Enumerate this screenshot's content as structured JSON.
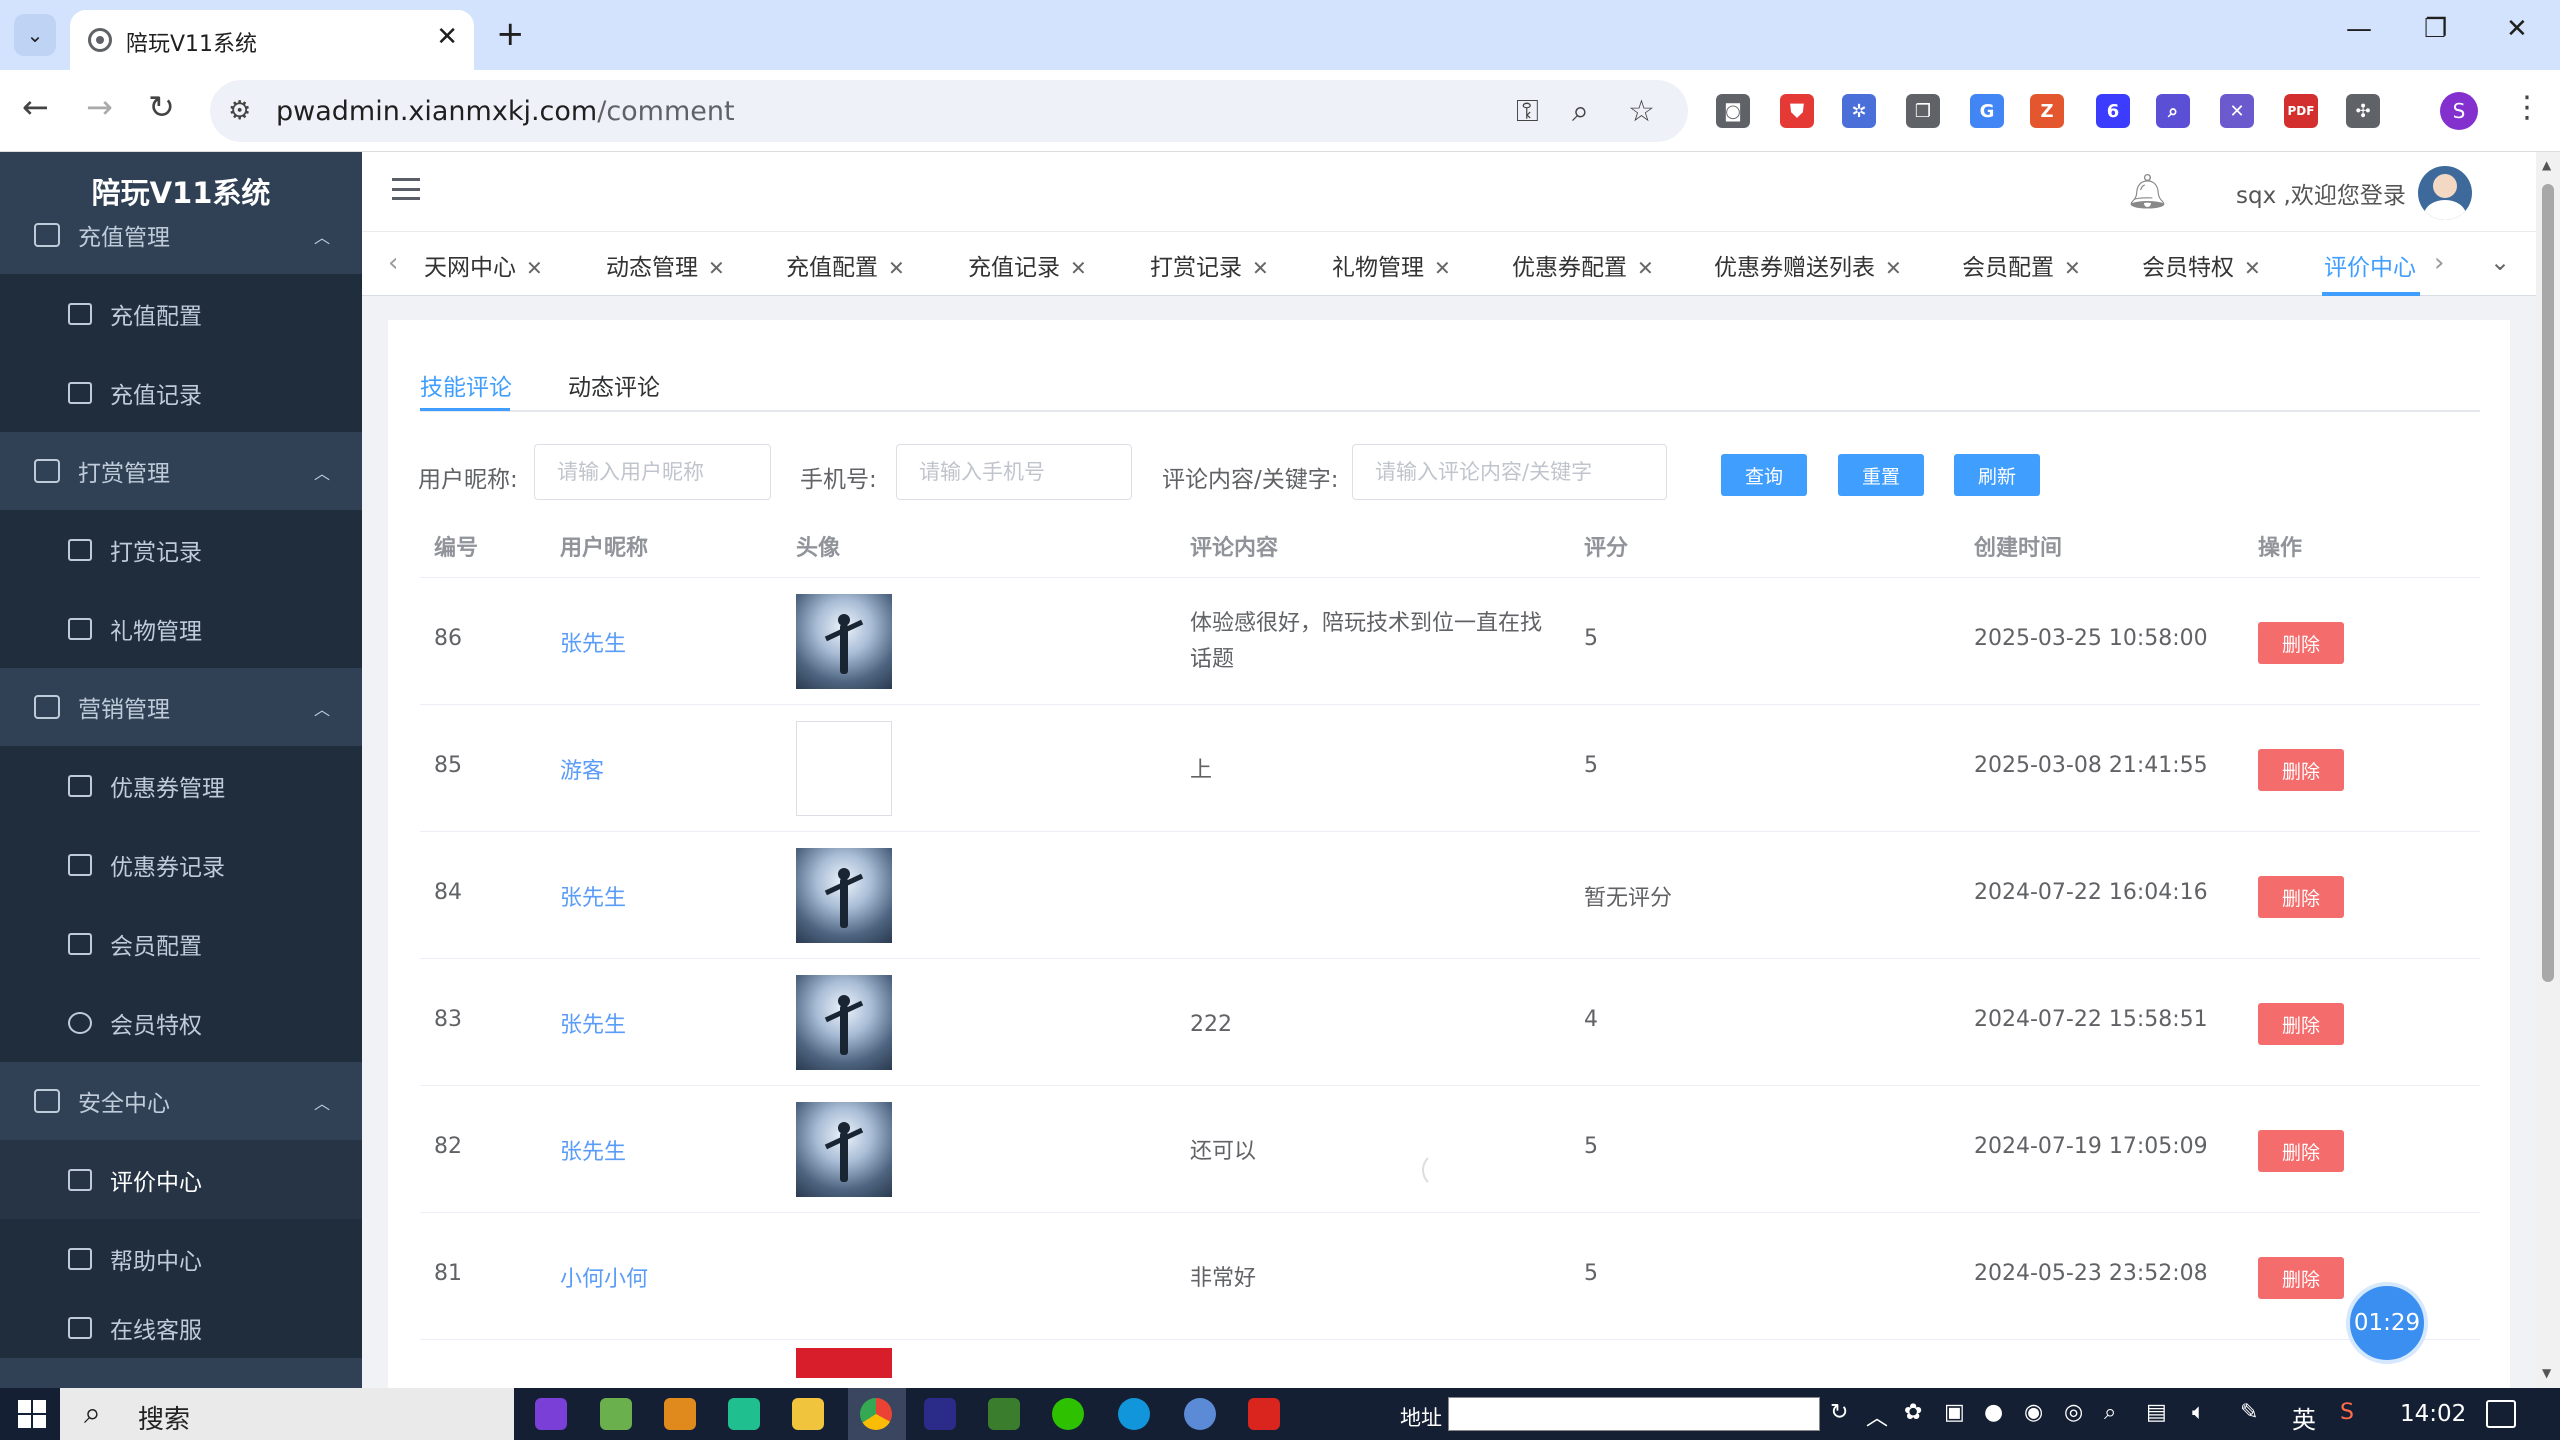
{
  "browser": {
    "tab_title": "陪玩V11系统",
    "url_host": "pwadmin.xianmxkj.com",
    "url_path": "/comment",
    "extensions": [
      {
        "name": "camera-icon",
        "color": "#5f6368",
        "glyph": "◙"
      },
      {
        "name": "shield-extension-icon",
        "color": "#e53935",
        "glyph": "⛊"
      },
      {
        "name": "network-extension-icon",
        "color": "#4a6fd8",
        "glyph": "✲"
      },
      {
        "name": "copy-extension-icon",
        "color": "#5f6368",
        "glyph": "❐"
      },
      {
        "name": "translate-extension-icon",
        "color": "#4285f4",
        "glyph": "G"
      },
      {
        "name": "zotero-extension-icon",
        "color": "#e4572e",
        "glyph": "Z"
      },
      {
        "name": "badge-extension-icon",
        "color": "#3c3cff",
        "glyph": "6"
      },
      {
        "name": "search-extension-icon",
        "color": "#5b4fd6",
        "glyph": "⌕"
      },
      {
        "name": "x-extension-icon",
        "color": "#6a5acd",
        "glyph": "✕"
      },
      {
        "name": "pdf-extension-icon",
        "color": "#d32f2f",
        "glyph": "PDF"
      },
      {
        "name": "puzzle-extension-icon",
        "color": "#5f6368",
        "glyph": "✣"
      }
    ],
    "profile_initial": "S"
  },
  "sidebar": {
    "logo": "陪玩V11系统",
    "sections": [
      {
        "label": "充值管理",
        "items": [
          "充值配置",
          "充值记录"
        ]
      },
      {
        "label": "打赏管理",
        "items": [
          "打赏记录",
          "礼物管理"
        ]
      },
      {
        "label": "营销管理",
        "items": [
          "优惠券管理",
          "优惠券记录",
          "会员配置",
          "会员特权"
        ]
      },
      {
        "label": "安全中心",
        "items": [
          "评价中心",
          "帮助中心",
          "在线客服"
        ]
      }
    ]
  },
  "header": {
    "welcome": "sqx ,欢迎您登录"
  },
  "tags": [
    "天网中心",
    "动态管理",
    "充值配置",
    "充值记录",
    "打赏记录",
    "礼物管理",
    "优惠券配置",
    "优惠券赠送列表",
    "会员配置",
    "会员特权",
    "评价中心"
  ],
  "active_tag": "评价中心",
  "subtabs": [
    "技能评论",
    "动态评论"
  ],
  "filters": {
    "nickname_label": "用户昵称:",
    "nickname_placeholder": "请输入用户昵称",
    "phone_label": "手机号:",
    "phone_placeholder": "请输入手机号",
    "keyword_label": "评论内容/关键字:",
    "keyword_placeholder": "请输入评论内容/关键字",
    "query_btn": "查询",
    "reset_btn": "重置",
    "refresh_btn": "刷新"
  },
  "table": {
    "headers": [
      "编号",
      "用户昵称",
      "头像",
      "评论内容",
      "评分",
      "创建时间",
      "操作"
    ],
    "delete_label": "删除",
    "rows": [
      {
        "id": "86",
        "name": "张先生",
        "avatar": "photo",
        "content": "体验感很好，陪玩技术到位一直在找话题",
        "score": "5",
        "time": "2025-03-25 10:58:00"
      },
      {
        "id": "85",
        "name": "游客",
        "avatar": "blank",
        "content": "上",
        "score": "5",
        "time": "2025-03-08 21:41:55"
      },
      {
        "id": "84",
        "name": "张先生",
        "avatar": "photo",
        "content": "",
        "score": "暂无评分",
        "time": "2024-07-22 16:04:16"
      },
      {
        "id": "83",
        "name": "张先生",
        "avatar": "photo",
        "content": "222",
        "score": "4",
        "time": "2024-07-22 15:58:51"
      },
      {
        "id": "82",
        "name": "张先生",
        "avatar": "photo",
        "content": "还可以",
        "score": "5",
        "time": "2024-07-19 17:05:09"
      },
      {
        "id": "81",
        "name": "小何小何",
        "avatar": "none",
        "content": "非常好",
        "score": "5",
        "time": "2024-05-23 23:52:08"
      }
    ]
  },
  "timer": "01:29",
  "taskbar": {
    "search": "搜索",
    "address_label": "地址",
    "ime": "英",
    "clock": "14:02"
  }
}
